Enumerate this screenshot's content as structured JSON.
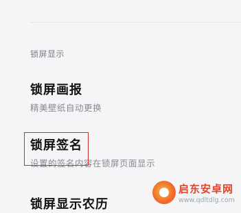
{
  "section": {
    "header": "锁屏显示"
  },
  "items": [
    {
      "title": "锁屏画报",
      "subtitle": "精美壁纸自动更换"
    },
    {
      "title": "锁屏签名",
      "subtitle": "设置的签名内容在锁屏页面显示"
    },
    {
      "title": "锁屏显示农历",
      "subtitle": ""
    }
  ],
  "watermark": {
    "title": "启东安卓网",
    "url": "www.qdltdlg.com",
    "logo_icon": "brand-logo-icon"
  },
  "colors": {
    "background": "#f5f5f7",
    "highlight": "#c9302c",
    "watermark_accent": "#e0452a"
  }
}
